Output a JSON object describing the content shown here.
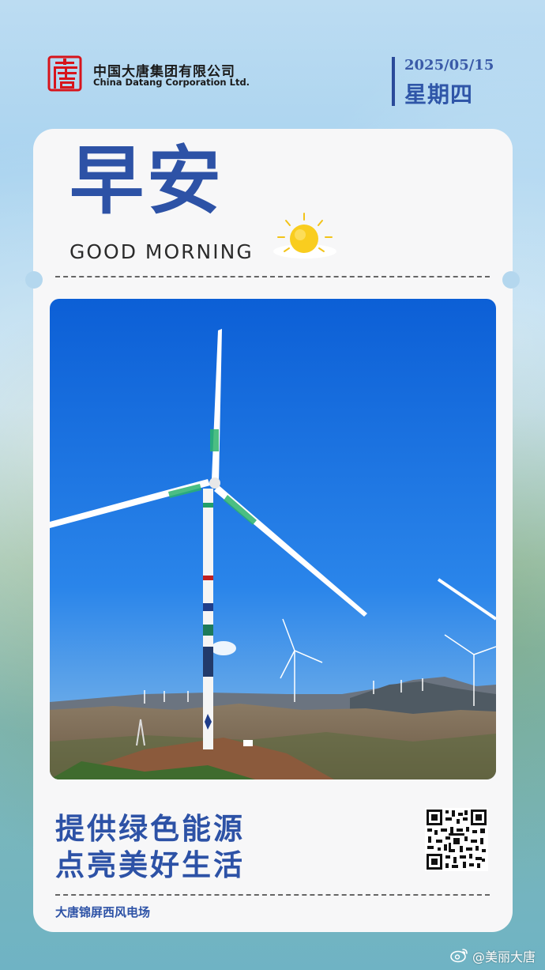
{
  "header": {
    "company_cn": "中国大唐集团有限公司",
    "company_en": "China Datang Corporation Ltd.",
    "date": "2025/05/15",
    "weekday": "星期四",
    "logo_glyph": "唐"
  },
  "greeting": {
    "title": "早安",
    "subtitle": "GOOD MORNING"
  },
  "slogan": {
    "line1": "提供绿色能源",
    "line2": "点亮美好生活"
  },
  "footer": {
    "site_name": "大唐锦屏西风电场"
  },
  "watermark": {
    "text": "@美丽大唐"
  },
  "colors": {
    "brand_blue": "#2d52a6",
    "logo_red": "#d7141b",
    "card_bg": "#f7f7f8"
  },
  "icons": {
    "logo": "datang-logo-icon",
    "sun": "sun-icon",
    "qr": "qr-code-icon",
    "weibo": "weibo-icon"
  }
}
